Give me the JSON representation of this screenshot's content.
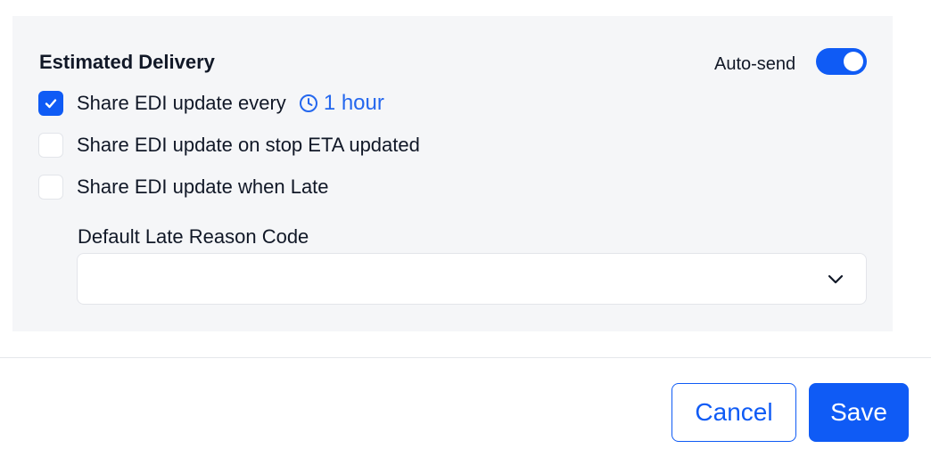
{
  "section": {
    "title": "Estimated Delivery"
  },
  "auto_send": {
    "label": "Auto-send",
    "enabled": true
  },
  "options": [
    {
      "label": "Share EDI update every",
      "checked": true
    },
    {
      "label": "Share EDI update on stop ETA updated",
      "checked": false
    },
    {
      "label": "Share EDI update when Late",
      "checked": false
    }
  ],
  "interval": {
    "value": "1 hour",
    "icon": "clock-icon"
  },
  "late_reason": {
    "label": "Default Late Reason Code",
    "value": ""
  },
  "actions": {
    "cancel_label": "Cancel",
    "save_label": "Save"
  },
  "colors": {
    "accent": "#0f5bf5",
    "link": "#2467ee",
    "panel_bg": "#f5f6f8"
  }
}
